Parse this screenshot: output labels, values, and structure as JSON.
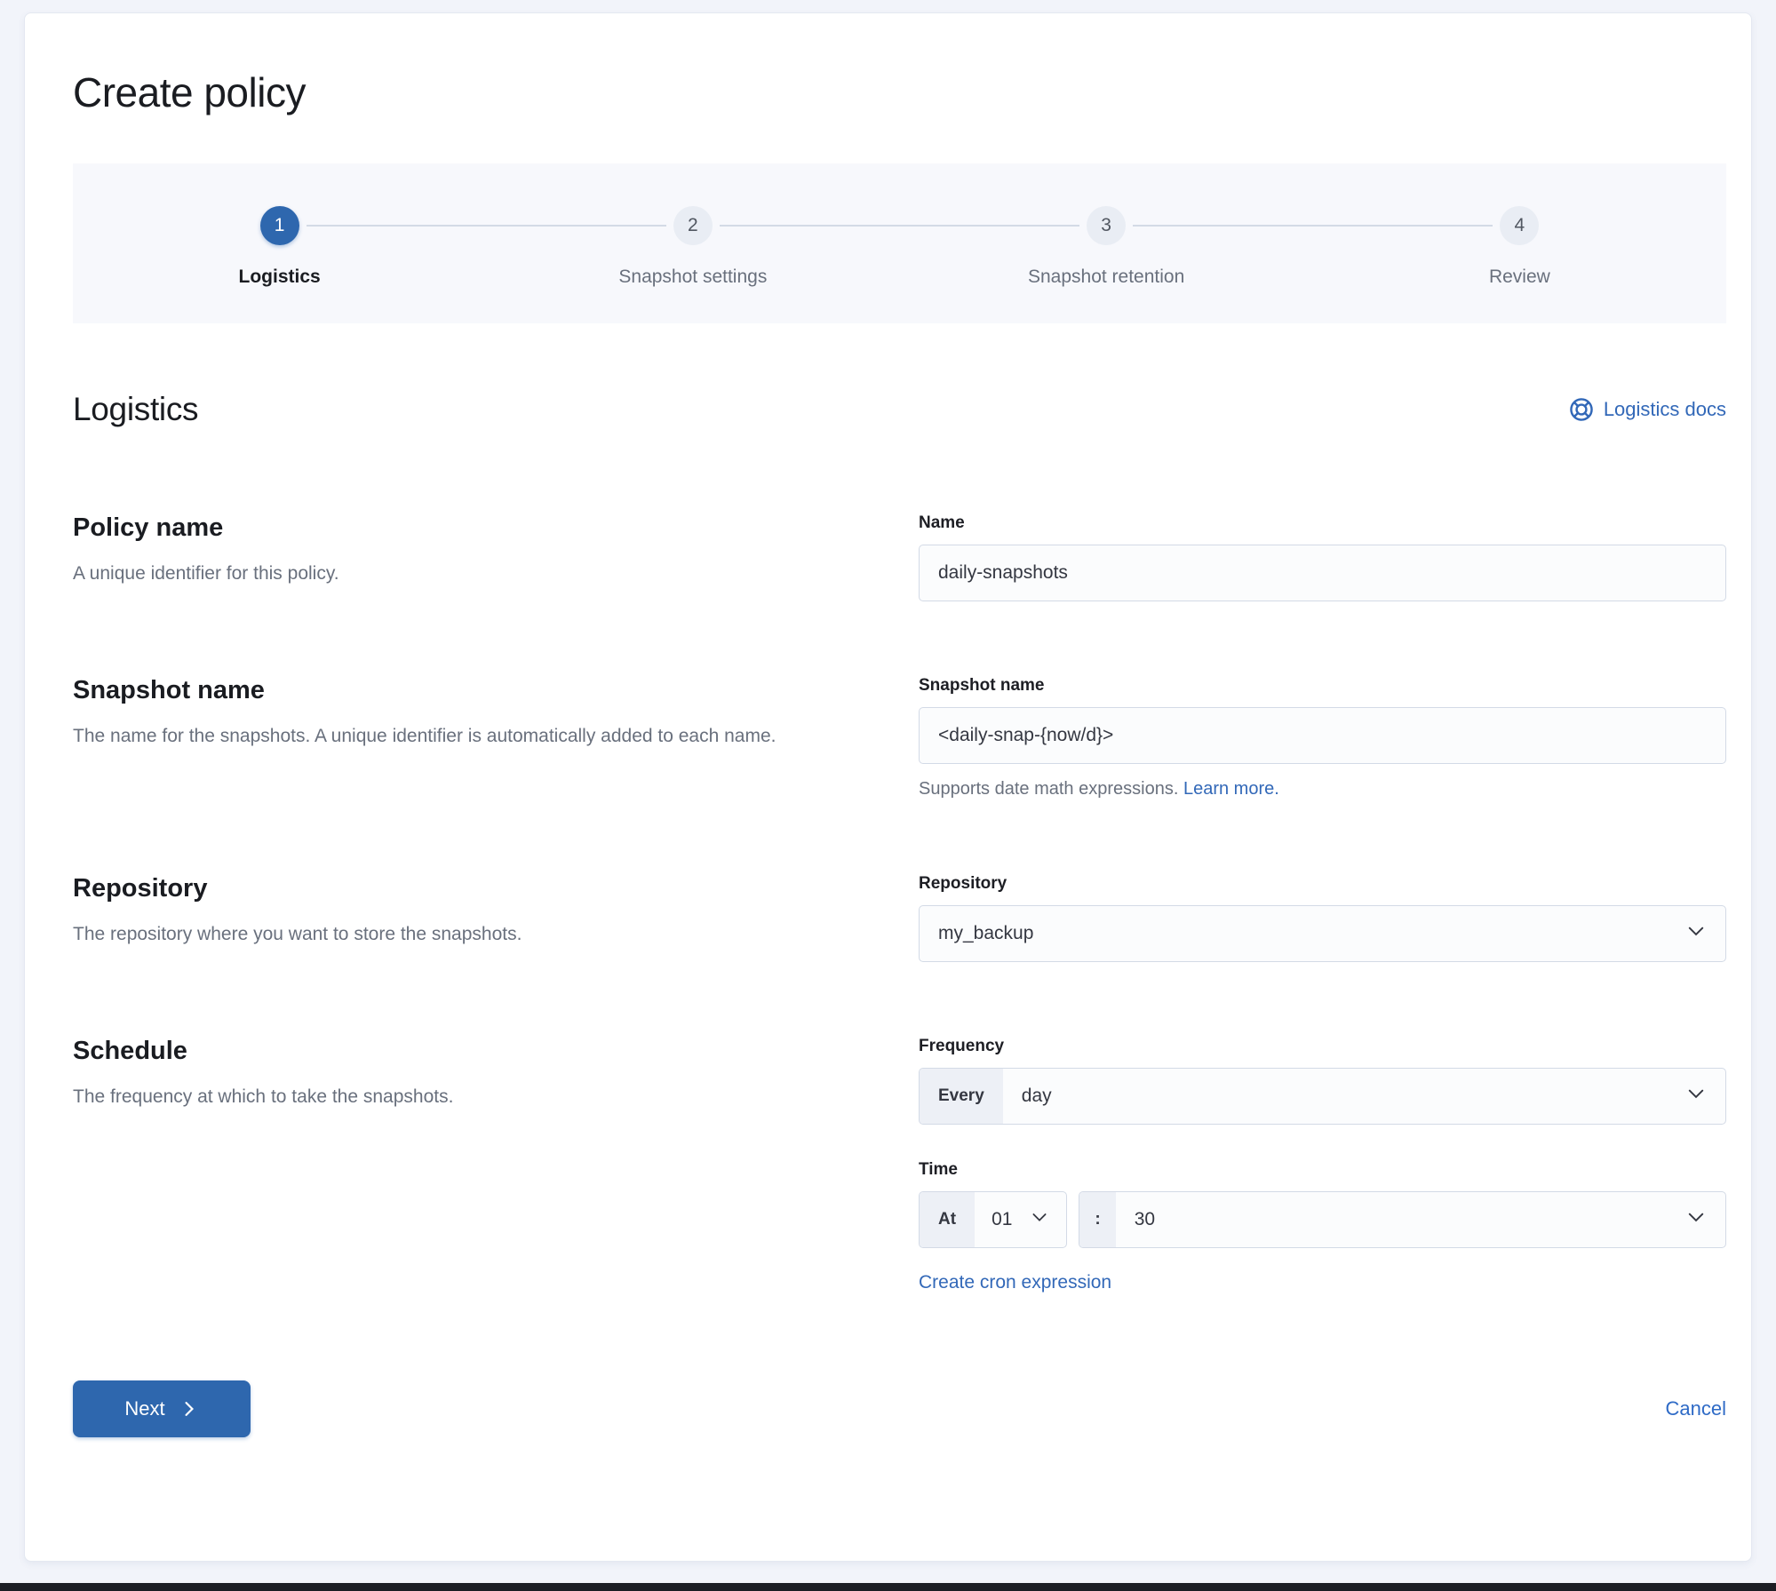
{
  "page": {
    "title": "Create policy"
  },
  "stepper": {
    "steps": [
      {
        "number": "1",
        "label": "Logistics"
      },
      {
        "number": "2",
        "label": "Snapshot settings"
      },
      {
        "number": "3",
        "label": "Snapshot retention"
      },
      {
        "number": "4",
        "label": "Review"
      }
    ]
  },
  "section": {
    "title": "Logistics",
    "docs_link_label": "Logistics docs"
  },
  "rows": {
    "policy_name": {
      "heading": "Policy name",
      "description": "A unique identifier for this policy.",
      "field_label": "Name",
      "field_value": "daily-snapshots"
    },
    "snapshot_name": {
      "heading": "Snapshot name",
      "description": "The name for the snapshots. A unique identifier is automatically added to each name.",
      "field_label": "Snapshot name",
      "field_value": "<daily-snap-{now/d}>",
      "help_text": "Supports date math expressions.",
      "help_link_label": "Learn more."
    },
    "repository": {
      "heading": "Repository",
      "description": "The repository where you want to store the snapshots.",
      "field_label": "Repository",
      "selected_value": "my_backup"
    },
    "schedule": {
      "heading": "Schedule",
      "description": "The frequency at which to take the snapshots.",
      "frequency_label": "Frequency",
      "frequency_prepend": "Every",
      "frequency_value": "day",
      "time_label": "Time",
      "time_prepend": "At",
      "hour_value": "01",
      "time_separator": ":",
      "minute_value": "30",
      "cron_link_label": "Create cron expression"
    }
  },
  "footer": {
    "next_label": "Next",
    "cancel_label": "Cancel"
  },
  "colors": {
    "primary": "#2e67ae",
    "link": "#3268b8",
    "text": "#1a1c21",
    "muted_text": "#69707d",
    "border": "#d3dae6",
    "field_background": "#fbfcfd",
    "prepend_background": "#edf0f6",
    "stepper_background": "#f7f8fc",
    "page_background": "#f2f4fa"
  }
}
